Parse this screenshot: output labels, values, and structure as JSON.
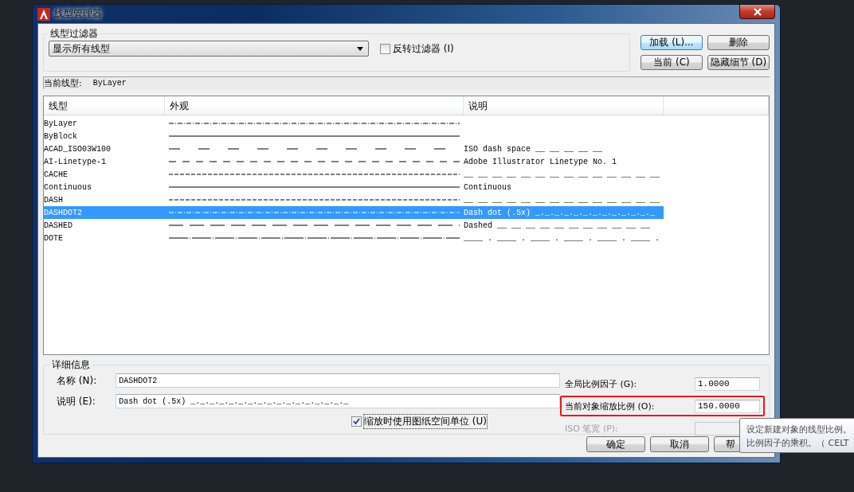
{
  "window": {
    "title": "线型管理器"
  },
  "filter": {
    "label": "线型过滤器",
    "value": "显示所有线型",
    "invert": {
      "label": "反转过滤器 (I)",
      "checked": false
    }
  },
  "buttons": [
    {
      "label": "加载 (L)...",
      "focused": true
    },
    {
      "label": "删除",
      "focused": false
    },
    {
      "label": "当前 (C)",
      "focused": false
    },
    {
      "label": "隐藏细节 (D)",
      "focused": false
    }
  ],
  "current": {
    "label": "当前线型:",
    "value": "ByLayer"
  },
  "table": {
    "columns": [
      "线型",
      "外观",
      "说明"
    ],
    "rows": [
      {
        "name": "ByLayer",
        "kind": "dashdot",
        "selected": false
      },
      {
        "name": "ByBlock",
        "kind": "continuous",
        "selected": false
      },
      {
        "name": "ACAD_ISO03W100",
        "kind": "dashgap",
        "description": "ISO dash space __   __   __   __   __",
        "selected": false
      },
      {
        "name": "AI-Linetype-1",
        "kind": "dash",
        "description": "Adobe Illustrator Linetype No. 1",
        "selected": false
      },
      {
        "name": "CACHE",
        "kind": "finedash",
        "description": "__ __ __ __ __ __ __ __ __ __ __ __ __ __",
        "selected": false
      },
      {
        "name": "Continuous",
        "kind": "continuous",
        "description": "Continuous",
        "selected": false
      },
      {
        "name": "DASH",
        "kind": "finedash",
        "description": "__ __ __ __ __ __ __ __ __ __ __ __ __ __",
        "selected": false
      },
      {
        "name": "DASHDOT2",
        "kind": "dashdot",
        "description": "Dash dot (.5x) _._._._._._._._._._._._._",
        "selected": true
      },
      {
        "name": "DASHED",
        "kind": "longdash",
        "description": "Dashed __ __ __ __ __ __ __ __ __ __ __",
        "selected": false
      },
      {
        "name": "DOTE",
        "kind": "longdashdot",
        "description": "____ . ____ . ____ . ____ . ____ . ____ .",
        "selected": false
      }
    ]
  },
  "details": {
    "label": "详细信息",
    "name": {
      "label": "名称 (N):",
      "value": "DASHDOT2"
    },
    "description": {
      "label": "说明 (E):",
      "value": "Dash dot (.5x) _._._._._._._._._._._._._._._._._"
    },
    "paper_space": {
      "label": "缩放时使用图纸空间单位 (U)",
      "checked": true
    },
    "global_scale": {
      "label": "全局比例因子 (G):",
      "value": "1.0000",
      "disabled": false,
      "highlighted": false
    },
    "object_scale": {
      "label": "当前对象缩放比例 (O):",
      "value": "150.0000",
      "disabled": false,
      "highlighted": true
    },
    "pen_width": {
      "label": "ISO 笔宽 (P):",
      "disabled": true,
      "highlighted": false
    }
  },
  "footer_buttons": [
    "确定",
    "取消",
    "帮"
  ],
  "tooltip": {
    "lines": [
      "设定新建对象的线型比例。",
      "比例因子的乘积。（ CELT"
    ]
  }
}
